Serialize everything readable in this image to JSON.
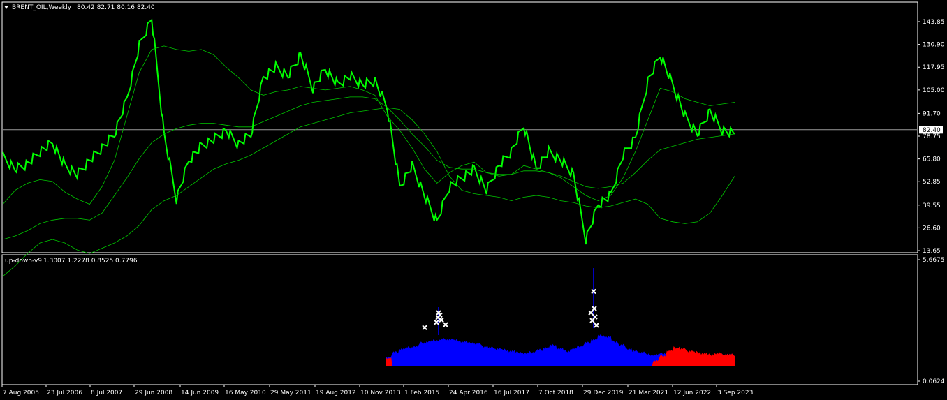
{
  "main_header": {
    "symbol": "BRENT_OIL,Weekly",
    "ohlc": "80.42 82.71 80.16 82.40"
  },
  "sub_header": {
    "indicator": "up-down-v9",
    "values": "1.3007 1.2278 0.8525 0.7796"
  },
  "colors": {
    "background": "#000000",
    "frame": "#ffffff",
    "price": "#00ff00",
    "bands": "#00c800",
    "current_line": "#9a9a9a",
    "hist_up": "#0000ff",
    "hist_down": "#ff0000",
    "marker": "#ffffff"
  },
  "chart_data": [
    {
      "type": "line",
      "title": "BRENT_OIL,Weekly",
      "y_ticks": [
        "143.85",
        "130.90",
        "117.95",
        "105.00",
        "91.70",
        "78.75",
        "65.80",
        "52.85",
        "39.55",
        "26.60",
        "13.65"
      ],
      "y_range": [
        13.65,
        143.85
      ],
      "current_price": "82.40",
      "x_ticks": [
        "7 Aug 2005",
        "23 Jul 2006",
        "8 Jul 2007",
        "29 Jun 2008",
        "14 Jun 2009",
        "16 May 2010",
        "29 May 2011",
        "19 Aug 2012",
        "10 Nov 2013",
        "1 Feb 2015",
        "24 Apr 2016",
        "16 Jul 2017",
        "7 Oct 2018",
        "29 Dec 2019",
        "21 Mar 2021",
        "12 Jun 2022",
        "3 Sep 2023"
      ],
      "series": [
        {
          "values": [
            67,
            60,
            63,
            70,
            75,
            62,
            57,
            65,
            72,
            80,
            100,
            130,
            146,
            80,
            43,
            65,
            73,
            77,
            82,
            74,
            80,
            112,
            118,
            113,
            125,
            106,
            117,
            108,
            113,
            108,
            110,
            95,
            50,
            62,
            45,
            30,
            50,
            55,
            60,
            48,
            62,
            70,
            85,
            60,
            70,
            65,
            57,
            20,
            40,
            45,
            68,
            78,
            110,
            125,
            108,
            90,
            80,
            93,
            82,
            80
          ]
        },
        {
          "values": [
            40,
            48,
            52,
            54,
            53,
            47,
            43,
            40,
            50,
            65,
            90,
            115,
            128,
            130,
            128,
            127,
            128,
            125,
            118,
            112,
            105,
            102,
            104,
            105,
            107,
            106,
            105,
            106,
            107,
            105,
            102,
            90,
            82,
            72,
            60,
            52,
            58,
            62,
            64,
            58,
            56,
            57,
            62,
            60,
            58,
            55,
            50,
            45,
            42,
            45,
            55,
            70,
            88,
            106,
            104,
            100,
            98,
            96,
            97,
            98
          ]
        },
        {
          "values": [
            20,
            22,
            25,
            29,
            31,
            32,
            32,
            31,
            35,
            45,
            55,
            66,
            75,
            80,
            83,
            85,
            86,
            86,
            85,
            84,
            84,
            87,
            90,
            93,
            96,
            98,
            99,
            100,
            101,
            101,
            100,
            95,
            88,
            80,
            73,
            65,
            61,
            60,
            60,
            58,
            57,
            57,
            59,
            59,
            58,
            56,
            53,
            50,
            49,
            50,
            52,
            58,
            65,
            71,
            73,
            75,
            77,
            78,
            79,
            80
          ]
        },
        {
          "values": [
            -1,
            5,
            12,
            18,
            20,
            18,
            14,
            12,
            15,
            18,
            22,
            28,
            37,
            42,
            45,
            50,
            55,
            60,
            63,
            65,
            68,
            72,
            76,
            80,
            84,
            86,
            88,
            90,
            92,
            93,
            94,
            95,
            94,
            88,
            80,
            70,
            56,
            48,
            46,
            45,
            44,
            42,
            44,
            45,
            44,
            42,
            41,
            39,
            38,
            39,
            41,
            43,
            40,
            32,
            30,
            29,
            30,
            35,
            45,
            56
          ]
        }
      ]
    },
    {
      "type": "area",
      "title": "up-down-v9",
      "y_ticks": [
        "5.6675",
        "0.0624"
      ],
      "y_range": [
        0.0624,
        5.6675
      ],
      "series": [
        {
          "values": [
            0.8,
            1.2,
            1.5,
            1.6,
            1.7,
            2.0,
            2.1,
            2.2,
            2.3,
            2.3,
            2.2,
            2.1,
            2.0,
            1.9,
            1.7,
            1.6,
            1.5,
            1.4,
            1.3,
            1.2,
            1.1,
            1.2,
            1.4,
            1.6,
            1.8,
            1.5,
            1.3,
            1.5,
            1.7,
            2.0,
            2.3,
            2.6,
            2.5,
            2.1,
            1.8,
            1.5,
            1.3,
            1.2,
            1.0,
            1.0,
            1.1,
            1.0,
            1.0,
            1.0,
            0.9,
            1.0,
            1.0,
            0.9,
            1.0,
            1.0,
            1.0,
            0.9
          ]
        },
        {
          "values": [
            0.7,
            0.0,
            0.0,
            0.0,
            0.0,
            0.0,
            0.0,
            0.0,
            0.0,
            0.0,
            0.0,
            0.0,
            0.0,
            0.0,
            0.0,
            0.0,
            0.0,
            0.0,
            0.0,
            0.0,
            0.0,
            0.0,
            0.0,
            0.0,
            0.0,
            0.0,
            0.0,
            0.0,
            0.0,
            0.0,
            0.0,
            0.0,
            0.0,
            0.0,
            0.0,
            0.0,
            0.0,
            0.0,
            0.0,
            0.5,
            0.9,
            1.3,
            1.6,
            1.5,
            1.3,
            1.2,
            1.1,
            1.0,
            1.1,
            1.0,
            1.0,
            0.9
          ]
        }
      ],
      "markers": [
        {
          "x": 0.0,
          "y": 2.1
        },
        {
          "x": 0.0,
          "y": 3.35
        },
        {
          "x": 0.0,
          "y": 3.15
        },
        {
          "x": 0.0,
          "y": 2.95
        },
        {
          "x": 0.0,
          "y": 2.75
        },
        {
          "x": 0.0,
          "y": 2.55
        },
        {
          "x": 0.0,
          "y": 2.35
        },
        {
          "x": 0.0,
          "y": 5.15
        },
        {
          "x": 0.0,
          "y": 3.7
        },
        {
          "x": 0.0,
          "y": 3.35
        },
        {
          "x": 0.0,
          "y": 3.0
        },
        {
          "x": 0.0,
          "y": 2.7
        },
        {
          "x": 0.0,
          "y": 2.3
        }
      ]
    }
  ]
}
